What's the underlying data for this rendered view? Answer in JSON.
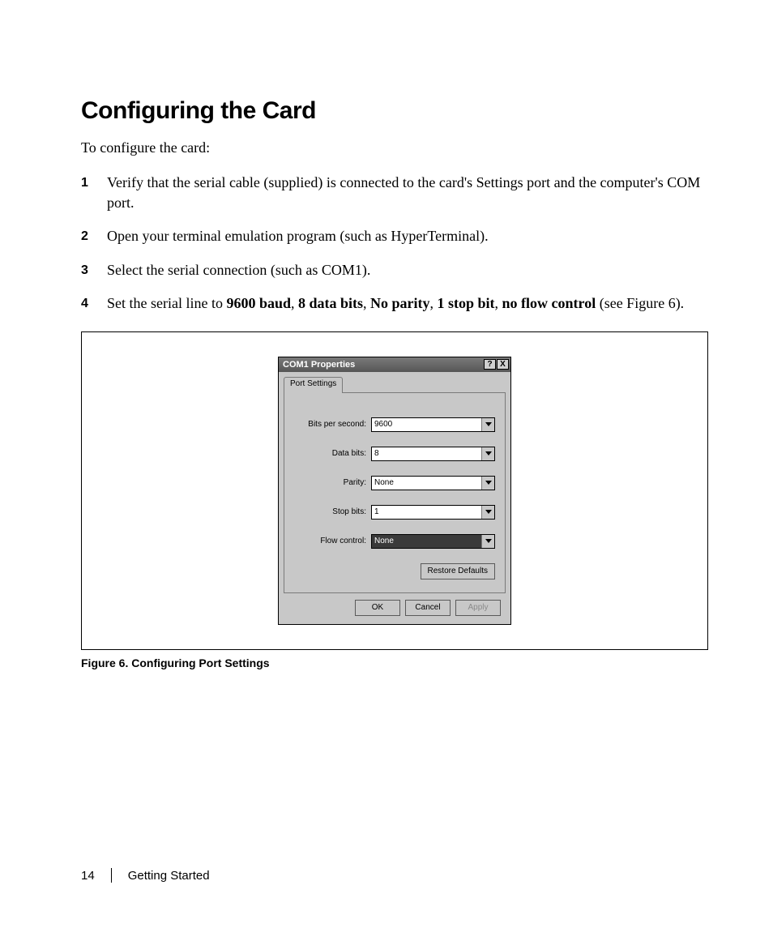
{
  "heading": "Configuring the Card",
  "intro": "To configure the card:",
  "steps": [
    {
      "num": "1",
      "text": "Verify that the serial cable (supplied) is connected to the card's Settings port and the computer's COM port."
    },
    {
      "num": "2",
      "text": "Open your terminal emulation program (such as HyperTerminal)."
    },
    {
      "num": "3",
      "text": "Select the serial connection (such as COM1)."
    },
    {
      "num": "4",
      "prefix": "Set the serial line to ",
      "bold": "9600 baud",
      "sep1": ", ",
      "bold2": "8 data bits",
      "sep2": ", ",
      "bold3": "No parity",
      "sep3": ", ",
      "bold4": "1 stop bit",
      "sep4": ", ",
      "bold5": "no flow control",
      "suffix": " (see Figure 6)."
    }
  ],
  "dialog": {
    "title": "COM1 Properties",
    "help": "?",
    "close": "X",
    "tab": "Port Settings",
    "fields": [
      {
        "label": "Bits per second:",
        "value": "9600",
        "selected": false
      },
      {
        "label": "Data bits:",
        "value": "8",
        "selected": false
      },
      {
        "label": "Parity:",
        "value": "None",
        "selected": false
      },
      {
        "label": "Stop bits:",
        "value": "1",
        "selected": false
      },
      {
        "label": "Flow control:",
        "value": "None",
        "selected": true
      }
    ],
    "restore": "Restore Defaults",
    "ok": "OK",
    "cancel": "Cancel",
    "apply": "Apply"
  },
  "figure_caption": "Figure 6. Configuring Port Settings",
  "footer": {
    "page": "14",
    "section": "Getting Started"
  }
}
